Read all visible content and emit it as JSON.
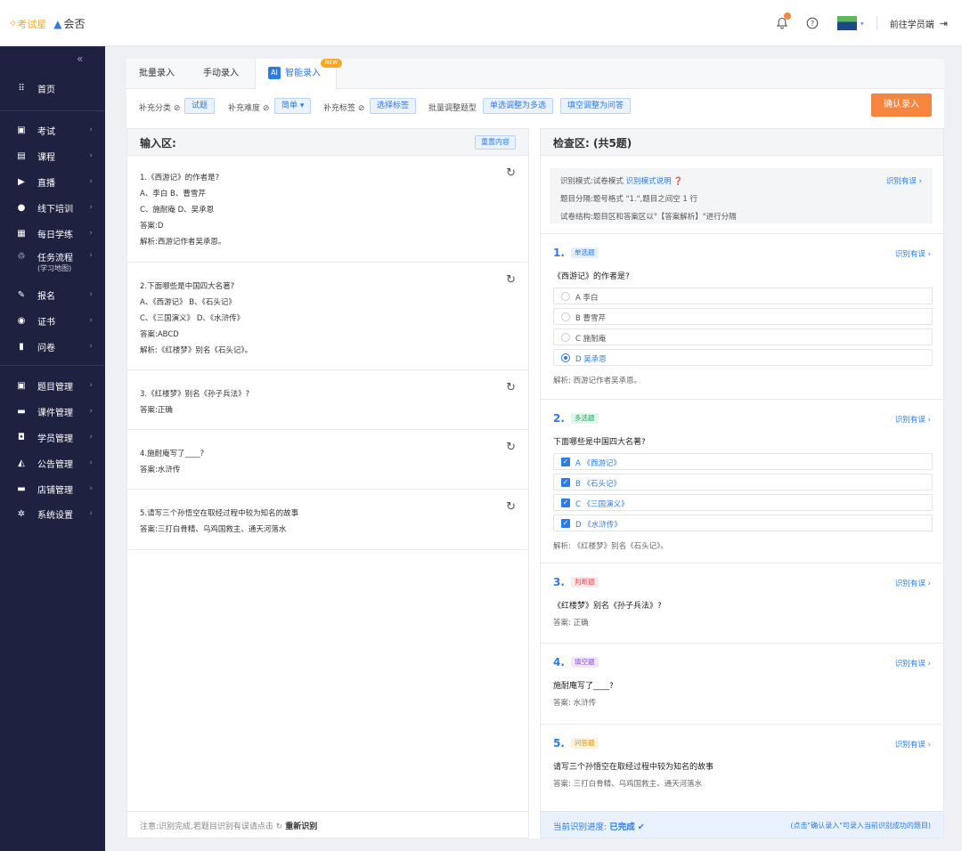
{
  "header": {
    "logo_part1": "考试星",
    "logo_part2": "会否",
    "student_link": "前往学员端"
  },
  "sidebar": {
    "items": [
      {
        "icon": "grid",
        "label": "首页"
      },
      {
        "icon": "clipboard",
        "label": "考试"
      },
      {
        "icon": "book",
        "label": "课程"
      },
      {
        "icon": "live",
        "label": "直播"
      },
      {
        "icon": "person",
        "label": "线下培训"
      },
      {
        "icon": "calendar",
        "label": "每日学练"
      },
      {
        "icon": "flow",
        "label": "任务流程",
        "sub": "(学习地图)"
      },
      {
        "icon": "edit",
        "label": "报名"
      },
      {
        "icon": "cert",
        "label": "证书"
      },
      {
        "icon": "doc",
        "label": "问卷"
      },
      {
        "icon": "question",
        "label": "题目管理"
      },
      {
        "icon": "folder",
        "label": "课件管理"
      },
      {
        "icon": "student",
        "label": "学员管理"
      },
      {
        "icon": "notice",
        "label": "公告管理"
      },
      {
        "icon": "store",
        "label": "店铺管理"
      },
      {
        "icon": "gear",
        "label": "系统设置"
      }
    ]
  },
  "tabs": [
    {
      "label": "批量录入"
    },
    {
      "label": "手动录入"
    },
    {
      "label": "智能录入",
      "ai": "AI",
      "badge": "NEW"
    }
  ],
  "toolbar": {
    "category_label": "补充分类",
    "category_value": "试题",
    "difficulty_label": "补充难度",
    "difficulty_value": "简单 ▾",
    "tag_label": "补充标签",
    "tag_value": "选择标签",
    "batch_label": "批量调整题型",
    "batch_btn1": "单选调整为多选",
    "batch_btn2": "填空调整为问答",
    "confirm": "确认录入"
  },
  "input_panel": {
    "title": "输入区:",
    "clear": "重置内容",
    "blocks": [
      [
        "1.《西游记》的作者是?",
        "A、李白    B、曹雪芹",
        "C、施耐庵    D、吴承恩",
        "答案:D",
        "解析:西游记作者吴承恩。"
      ],
      [
        "2.下面哪些是中国四大名著?",
        "A、《西游记》  B、《石头记》",
        "C、《三国演义》  D、《水浒传》",
        "答案:ABCD",
        "解析:《红楼梦》别名《石头记》。"
      ],
      [
        "3.《红楼梦》别名《孙子兵法》?",
        "答案:正确"
      ],
      [
        "4.施耐庵写了____?",
        "答案:水浒传"
      ],
      [
        "5.请写三个孙悟空在取经过程中较为知名的故事",
        "答案:三打白骨精、乌鸡国救主、通天河落水"
      ]
    ],
    "footer_note": "注意:识别完成,若题目识别有误请点击",
    "footer_action": "重新识别"
  },
  "check_panel": {
    "title": "检查区: (共5题)",
    "mode_label": "识别模式:试卷模式",
    "mode_link": "识别模式说明",
    "split_label": "题目分隔:题号格式 \"1.\",题目之间空 1 行",
    "structure_label": "试卷结构:题目区和答案区以\"【答案解析】\"进行分隔",
    "report": "识别有误",
    "questions": [
      {
        "num": "1.",
        "type": "单选题",
        "stem": "《西游记》的作者是?",
        "options": [
          "A  李白",
          "B  曹雪芹",
          "C  施耐庵",
          "D  吴承恩"
        ],
        "explain": "解析:   西游记作者吴承恩。"
      },
      {
        "num": "2.",
        "type": "多选题",
        "stem": "下面哪些是中国四大名著?",
        "options": [
          "A  《西游记》",
          "B  《石头记》",
          "C  《三国演义》",
          "D  《水浒传》"
        ],
        "explain": "解析:   《红楼梦》别名《石头记》。"
      },
      {
        "num": "3.",
        "type": "判断题",
        "stem": "《红楼梦》别名《孙子兵法》?",
        "explain": "答案:  正确"
      },
      {
        "num": "4.",
        "type": "填空题",
        "stem": "施耐庵写了____?",
        "explain": "答案:  水浒传"
      },
      {
        "num": "5.",
        "type": "问答题",
        "stem": "请写三个孙悟空在取经过程中较为知名的故事",
        "explain": "答案:  三打白骨精、乌鸡国救主、通天河落水"
      }
    ],
    "progress_label": "当前识别进度:",
    "progress_value": "已完成",
    "progress_hint": "(点击\"确认录入\"可录入当前识别成功的题目)"
  },
  "colors": {
    "accent": "#2d7be5",
    "confirm": "#f5853f",
    "sidebar": "#1f2140",
    "tag_single_bg": "#e6f0fd",
    "tag_multi_bg": "#e3f6ec",
    "tag_judge_bg": "#fde8ea",
    "tag_fill_bg": "#f1e8fb",
    "tag_essay_bg": "#fdf3dc"
  }
}
